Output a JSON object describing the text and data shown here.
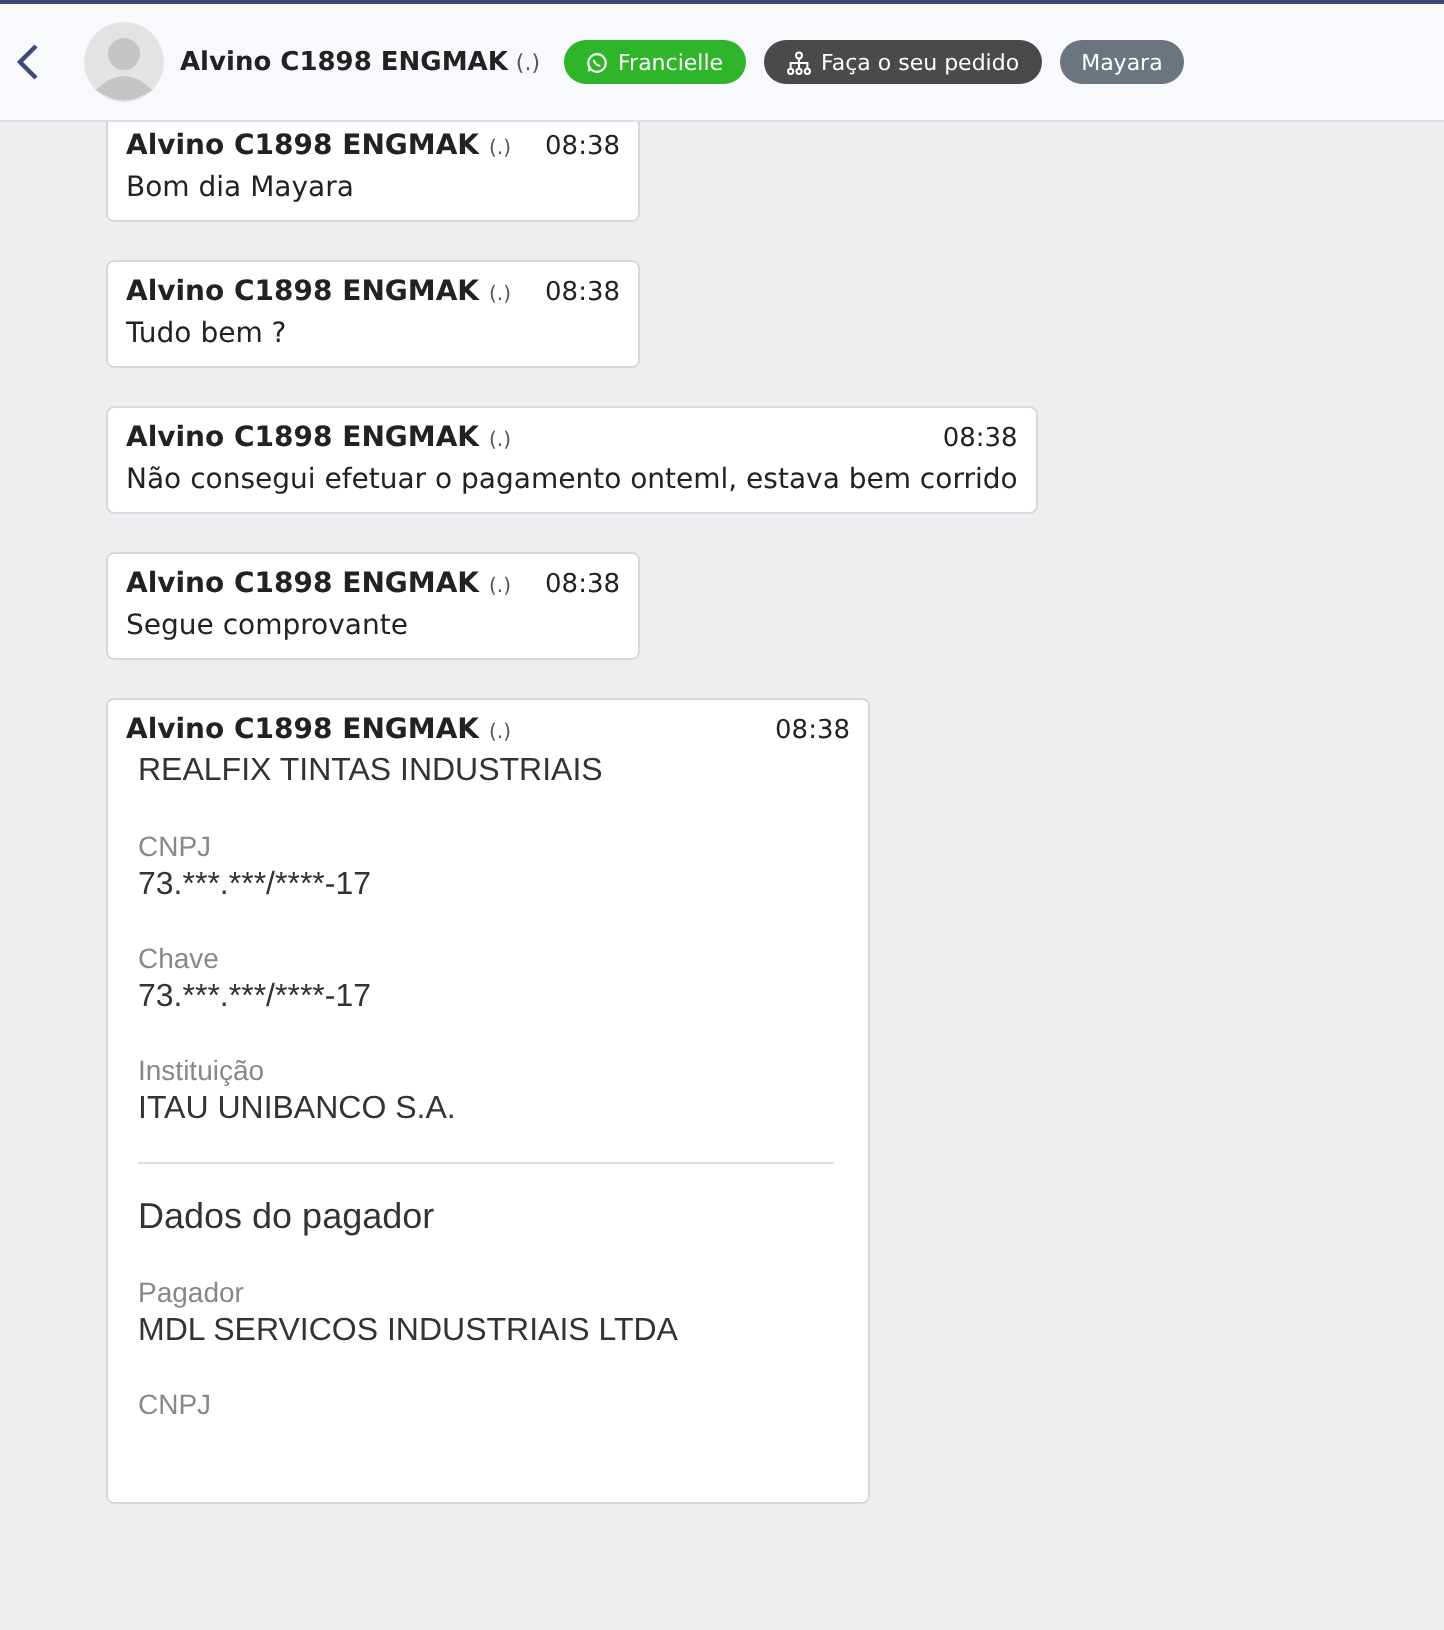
{
  "header": {
    "contact_name": "Alvino C1898 ENGMAK",
    "contact_status": "(.)",
    "tags": [
      {
        "kind": "whatsapp",
        "label": "Francielle",
        "color": "#2fb52a"
      },
      {
        "kind": "order",
        "label": "Faça o seu pedido",
        "color": "#4a4a4a"
      },
      {
        "kind": "plain",
        "label": "Mayara",
        "color": "#6c757d"
      }
    ]
  },
  "messages": [
    {
      "kind": "text",
      "sender": "Alvino C1898 ENGMAK",
      "status": "(.)",
      "time": "08:38",
      "text": "Bom dia Mayara"
    },
    {
      "kind": "text",
      "sender": "Alvino C1898 ENGMAK",
      "status": "(.)",
      "time": "08:38",
      "text": "Tudo bem ?"
    },
    {
      "kind": "text",
      "sender": "Alvino C1898 ENGMAK",
      "status": "(.)",
      "time": "08:38",
      "text": "Não consegui efetuar o pagamento onteml, estava bem corrido"
    },
    {
      "kind": "text",
      "sender": "Alvino C1898 ENGMAK",
      "status": "(.)",
      "time": "08:38",
      "text": "Segue comprovante"
    },
    {
      "kind": "receipt",
      "sender": "Alvino C1898 ENGMAK",
      "status": "(.)",
      "time": "08:38",
      "items": [
        {
          "kind": "title",
          "text": "REALFIX TINTAS INDUSTRIAIS"
        },
        {
          "kind": "field",
          "label": "CNPJ",
          "value": "73.***.***/****-17"
        },
        {
          "kind": "field",
          "label": "Chave",
          "value": "73.***.***/****-17"
        },
        {
          "kind": "field",
          "label": "Instituição",
          "value": "ITAU UNIBANCO S.A."
        },
        {
          "kind": "section",
          "text": "Dados do pagador"
        },
        {
          "kind": "field",
          "label": "Pagador",
          "value": "MDL SERVICOS INDUSTRIAIS LTDA"
        },
        {
          "kind": "field",
          "label": "CNPJ"
        }
      ]
    }
  ]
}
